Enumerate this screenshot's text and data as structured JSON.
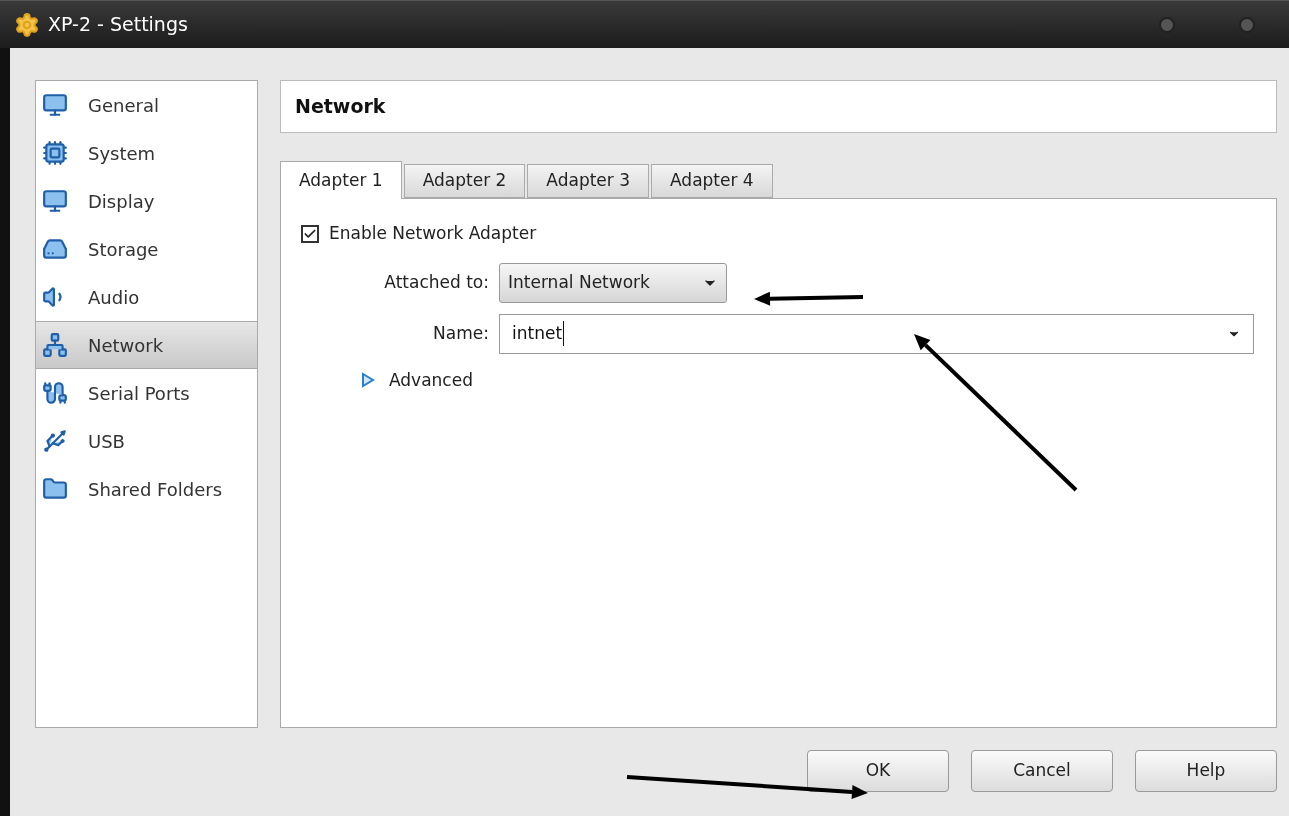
{
  "window": {
    "title": "XP-2 - Settings"
  },
  "sidebar": {
    "items": [
      {
        "label": "General",
        "selected": false
      },
      {
        "label": "System",
        "selected": false
      },
      {
        "label": "Display",
        "selected": false
      },
      {
        "label": "Storage",
        "selected": false
      },
      {
        "label": "Audio",
        "selected": false
      },
      {
        "label": "Network",
        "selected": true
      },
      {
        "label": "Serial Ports",
        "selected": false
      },
      {
        "label": "USB",
        "selected": false
      },
      {
        "label": "Shared Folders",
        "selected": false
      }
    ]
  },
  "page": {
    "title": "Network"
  },
  "tabs": [
    {
      "label": "Adapter 1",
      "selected": true
    },
    {
      "label": "Adapter 2",
      "selected": false
    },
    {
      "label": "Adapter 3",
      "selected": false
    },
    {
      "label": "Adapter 4",
      "selected": false
    }
  ],
  "adapter": {
    "enable": {
      "label": "Enable Network Adapter",
      "checked": true
    },
    "attached_to": {
      "label": "Attached to:",
      "value": "Internal Network"
    },
    "name": {
      "label": "Name:",
      "value": "intnet"
    },
    "advanced": {
      "label": "Advanced",
      "expanded": false
    }
  },
  "buttons": [
    "OK",
    "Cancel",
    "Help"
  ]
}
